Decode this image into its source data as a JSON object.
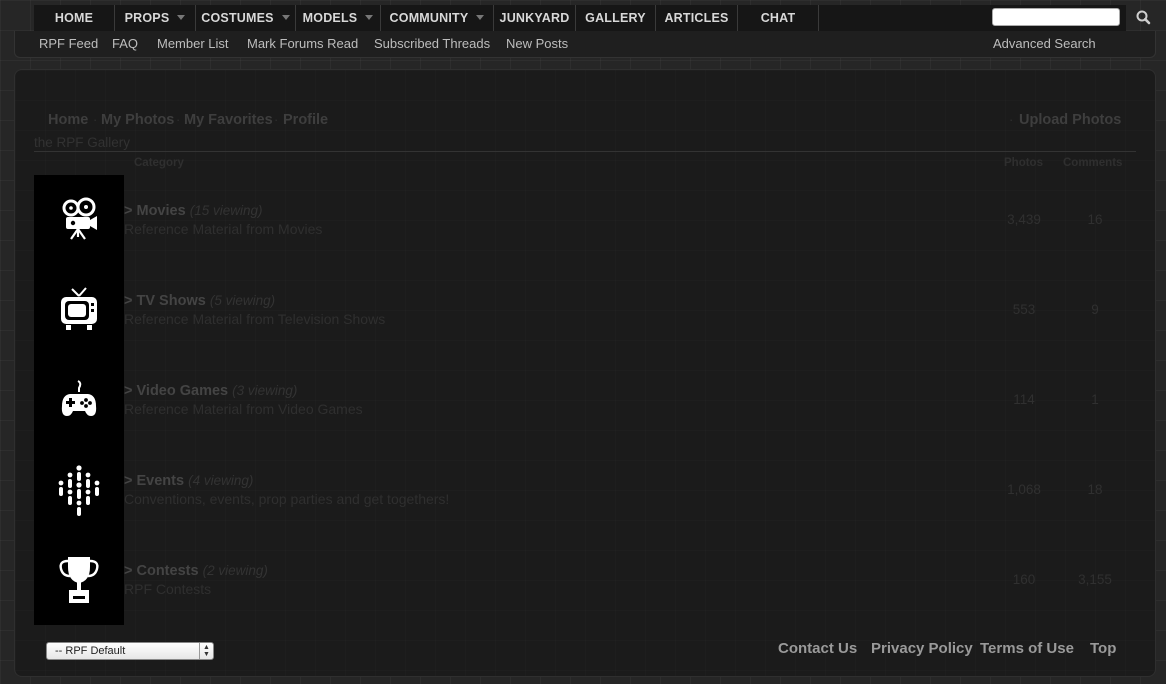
{
  "topnav": {
    "items": [
      {
        "label": "HOME",
        "dropdown": false
      },
      {
        "label": "PROPS",
        "dropdown": true
      },
      {
        "label": "COSTUMES",
        "dropdown": true
      },
      {
        "label": "MODELS",
        "dropdown": true
      },
      {
        "label": "COMMUNITY",
        "dropdown": true
      },
      {
        "label": "JUNKYARD",
        "dropdown": false
      },
      {
        "label": "GALLERY",
        "dropdown": false
      },
      {
        "label": "ARTICLES",
        "dropdown": false
      },
      {
        "label": "CHAT",
        "dropdown": false
      }
    ],
    "search": {
      "value": "",
      "icon": "search-icon"
    }
  },
  "subnav": {
    "items": [
      "RPF Feed",
      "FAQ",
      "Member List",
      "Mark Forums Read",
      "Subscribed Threads",
      "New Posts"
    ],
    "advanced_search": "Advanced Search"
  },
  "gallery": {
    "breadcrumbs": [
      "Home",
      "My Photos",
      "My Favorites",
      "Profile"
    ],
    "upload": "Upload Photos",
    "title": "the RPF Gallery",
    "columns": {
      "category": "Category",
      "photos": "Photos",
      "comments": "Comments"
    },
    "categories": [
      {
        "icon": "movie-camera-icon",
        "prefix": ">",
        "name": "Movies",
        "viewing": "(15 viewing)",
        "description": "Reference Material from Movies",
        "photos": "3,439",
        "comments": "16"
      },
      {
        "icon": "television-icon",
        "prefix": ">",
        "name": "TV Shows",
        "viewing": "(5 viewing)",
        "description": "Reference Material from Television Shows",
        "photos": "553",
        "comments": "9"
      },
      {
        "icon": "gamepad-icon",
        "prefix": ">",
        "name": "Video Games",
        "viewing": "(3 viewing)",
        "description": "Reference Material from Video Games",
        "photos": "114",
        "comments": "1"
      },
      {
        "icon": "crowd-icon",
        "prefix": ">",
        "name": "Events",
        "viewing": "(4 viewing)",
        "description": "Conventions, events, prop parties and get togethers!",
        "photos": "1,068",
        "comments": "18"
      },
      {
        "icon": "trophy-icon",
        "prefix": ">",
        "name": "Contests",
        "viewing": "(2 viewing)",
        "description": "RPF Contests",
        "photos": "160",
        "comments": "3,155"
      }
    ]
  },
  "footer": {
    "style_select": "-- RPF Default",
    "links": [
      "Contact Us",
      "Privacy Policy",
      "Terms of Use",
      "Top"
    ]
  }
}
